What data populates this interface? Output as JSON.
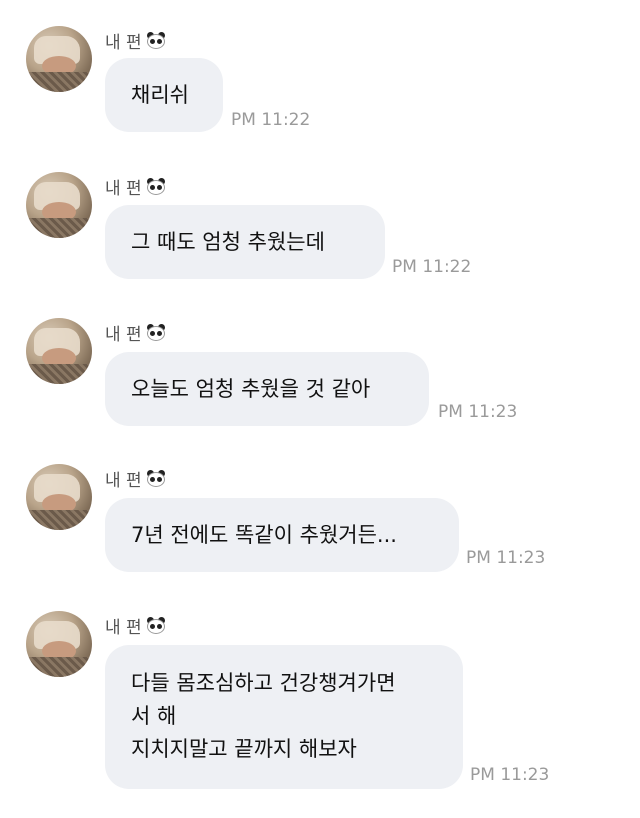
{
  "messages": [
    {
      "sender": "내 편",
      "sender_icon": "panda-emoji",
      "text": "채리쉬",
      "time": "PM 11:22"
    },
    {
      "sender": "내 편",
      "sender_icon": "panda-emoji",
      "text": "그 때도 엄청 추웠는데",
      "time": "PM 11:22"
    },
    {
      "sender": "내 편",
      "sender_icon": "panda-emoji",
      "text": "오늘도 엄청 추웠을 것 같아",
      "time": "PM 11:23"
    },
    {
      "sender": "내 편",
      "sender_icon": "panda-emoji",
      "text": "7년 전에도 똑같이 추웠거든...",
      "time": "PM 11:23"
    },
    {
      "sender": "내 편",
      "sender_icon": "panda-emoji",
      "text": "다들 몸조심하고 건강챙겨가면\n서 해\n지치지말고 끝까지 해보자",
      "time": "PM 11:23"
    }
  ],
  "colors": {
    "bubble_bg": "#eef0f4",
    "time_text": "#9a9a9a",
    "name_text": "#555555",
    "message_text": "#111111"
  }
}
